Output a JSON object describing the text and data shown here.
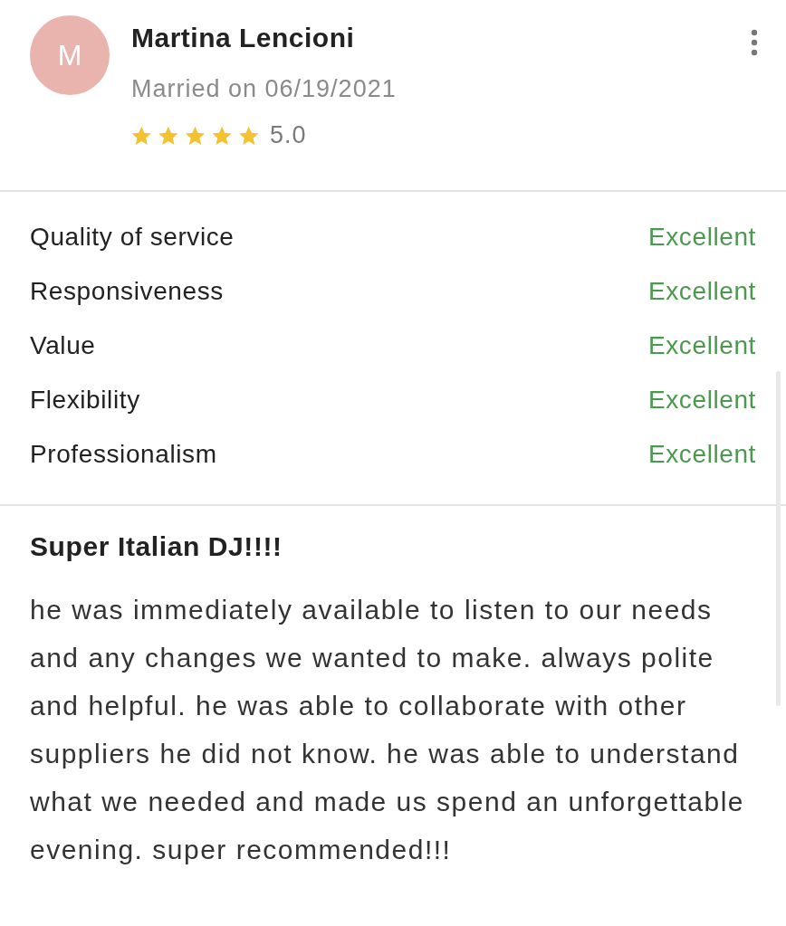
{
  "reviewer": {
    "initial": "M",
    "name": "Martina Lencioni",
    "married": "Married on 06/19/2021",
    "stars": 5,
    "score": "5.0"
  },
  "ratings": [
    {
      "label": "Quality of service",
      "value": "Excellent"
    },
    {
      "label": "Responsiveness",
      "value": "Excellent"
    },
    {
      "label": "Value",
      "value": "Excellent"
    },
    {
      "label": "Flexibility",
      "value": "Excellent"
    },
    {
      "label": "Professionalism",
      "value": "Excellent"
    }
  ],
  "review": {
    "title": "Super Italian DJ!!!!",
    "body": "he was immediately available to listen to our needs and any changes we wanted to make. always polite and helpful. he was able to collaborate with other suppliers he did not know. he was able to understand what we needed and made us spend an unforgettable evening. super recommended!!!"
  }
}
